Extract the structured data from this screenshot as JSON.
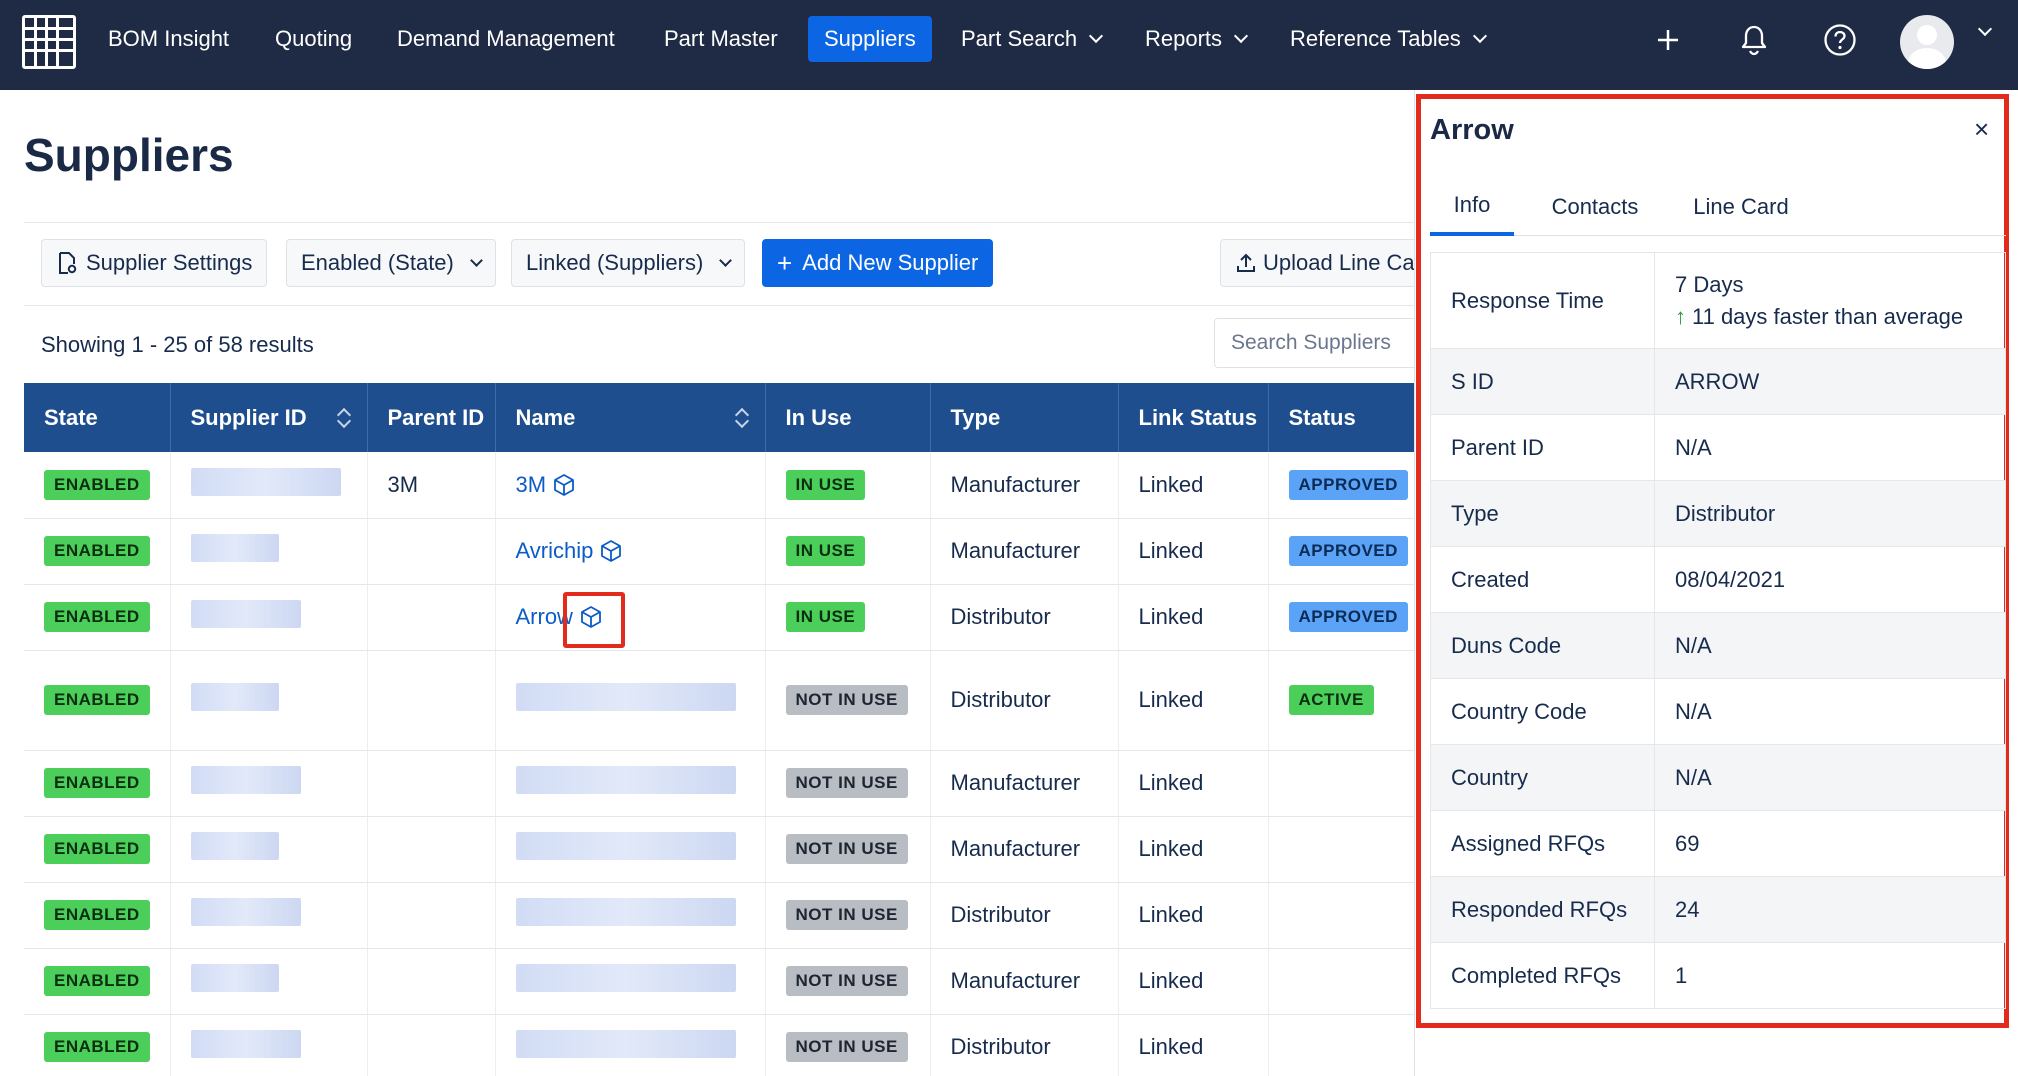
{
  "nav": {
    "items": [
      {
        "label": "BOM Insight"
      },
      {
        "label": "Quoting"
      },
      {
        "label": "Demand Management"
      },
      {
        "label": "Part Master"
      },
      {
        "label": "Suppliers",
        "active": true
      },
      {
        "label": "Part Search",
        "dropdown": true
      },
      {
        "label": "Reports",
        "dropdown": true
      },
      {
        "label": "Reference Tables",
        "dropdown": true
      }
    ],
    "icons": [
      "apps-grid-icon",
      "plus-icon",
      "bell-icon",
      "help-icon",
      "avatar-icon"
    ]
  },
  "page": {
    "title": "Suppliers"
  },
  "toolbar": {
    "supplier_settings": "Supplier Settings",
    "state_filter": "Enabled (State)",
    "linked_filter": "Linked (Suppliers)",
    "add_new": "Add New Supplier",
    "upload": "Upload Line Ca"
  },
  "results": {
    "text": "Showing 1 - 25 of 58 results"
  },
  "search": {
    "placeholder": "Search Suppliers"
  },
  "table": {
    "headers": [
      "State",
      "Supplier ID",
      "Parent ID",
      "Name",
      "In Use",
      "Type",
      "Link Status",
      "Status"
    ],
    "rows": [
      {
        "state": "ENABLED",
        "parent_id": "3M",
        "name": "3M",
        "in_use": "IN USE",
        "type": "Manufacturer",
        "link": "Linked",
        "status": "APPROVED"
      },
      {
        "state": "ENABLED",
        "parent_id": "",
        "name": "Avrichip",
        "in_use": "IN USE",
        "type": "Manufacturer",
        "link": "Linked",
        "status": "APPROVED"
      },
      {
        "state": "ENABLED",
        "parent_id": "",
        "name": "Arrow",
        "in_use": "IN USE",
        "type": "Distributor",
        "link": "Linked",
        "status": "APPROVED"
      },
      {
        "state": "ENABLED",
        "parent_id": "",
        "name": "",
        "in_use": "NOT IN USE",
        "type": "Distributor",
        "link": "Linked",
        "status": "ACTIVE"
      },
      {
        "state": "ENABLED",
        "parent_id": "",
        "name": "",
        "in_use": "NOT IN USE",
        "type": "Manufacturer",
        "link": "Linked",
        "status": ""
      },
      {
        "state": "ENABLED",
        "parent_id": "",
        "name": "",
        "in_use": "NOT IN USE",
        "type": "Manufacturer",
        "link": "Linked",
        "status": ""
      },
      {
        "state": "ENABLED",
        "parent_id": "",
        "name": "",
        "in_use": "NOT IN USE",
        "type": "Distributor",
        "link": "Linked",
        "status": ""
      },
      {
        "state": "ENABLED",
        "parent_id": "",
        "name": "",
        "in_use": "NOT IN USE",
        "type": "Manufacturer",
        "link": "Linked",
        "status": ""
      },
      {
        "state": "ENABLED",
        "parent_id": "",
        "name": "",
        "in_use": "NOT IN USE",
        "type": "Distributor",
        "link": "Linked",
        "status": ""
      }
    ]
  },
  "panel": {
    "title": "Arrow",
    "close": "×",
    "tabs": [
      {
        "label": "Info",
        "active": true
      },
      {
        "label": "Contacts"
      },
      {
        "label": "Line Card"
      }
    ],
    "fields": [
      {
        "key": "Response Time",
        "value": "7 Days",
        "sub": "11 days faster than average"
      },
      {
        "key": "S ID",
        "value": "ARROW"
      },
      {
        "key": "Parent ID",
        "value": "N/A"
      },
      {
        "key": "Type",
        "value": "Distributor"
      },
      {
        "key": "Created",
        "value": "08/04/2021"
      },
      {
        "key": "Duns Code",
        "value": "N/A"
      },
      {
        "key": "Country Code",
        "value": "N/A"
      },
      {
        "key": "Country",
        "value": "N/A"
      },
      {
        "key": "Assigned RFQs",
        "value": "69"
      },
      {
        "key": "Responded RFQs",
        "value": "24"
      },
      {
        "key": "Completed RFQs",
        "value": "1"
      }
    ]
  },
  "colors": {
    "nav_bg": "#1f2a44",
    "accent": "#0c66e4",
    "table_header": "#1f4e8f",
    "enabled": "#4bce5a",
    "approved": "#5aa3f7",
    "highlight": "#e32b1d"
  }
}
